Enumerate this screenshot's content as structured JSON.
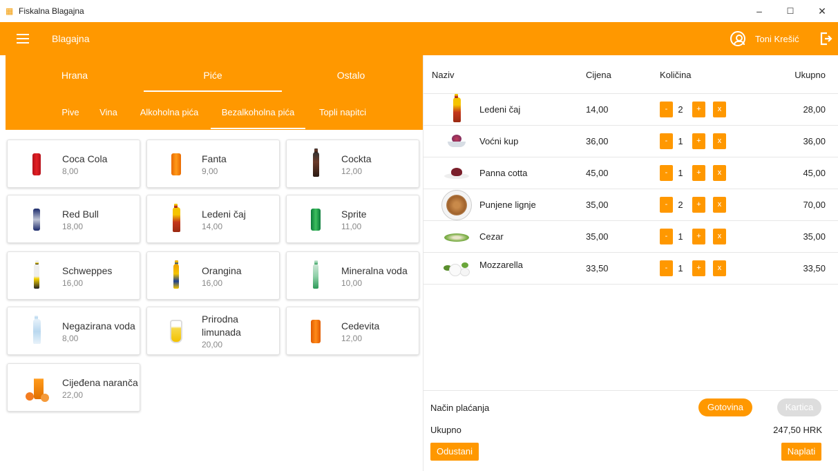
{
  "window": {
    "title": "Fiskalna Blagajna",
    "minimize": "–",
    "maximize": "☐",
    "close": "✕"
  },
  "appbar": {
    "title": "Blagajna",
    "user": "Toni Krešić"
  },
  "categories": [
    {
      "label": "Hrana",
      "active": false
    },
    {
      "label": "Piće",
      "active": true
    },
    {
      "label": "Ostalo",
      "active": false
    }
  ],
  "subcategories": [
    {
      "label": "Pive",
      "active": false
    },
    {
      "label": "Vina",
      "active": false
    },
    {
      "label": "Alkoholna pića",
      "active": false
    },
    {
      "label": "Bezalkoholna pića",
      "active": true
    },
    {
      "label": "Topli napitci",
      "active": false
    }
  ],
  "products": [
    {
      "name": "Coca Cola",
      "price": "8,00",
      "icon": "can-red"
    },
    {
      "name": "Fanta",
      "price": "9,00",
      "icon": "can-orange"
    },
    {
      "name": "Cockta",
      "price": "12,00",
      "icon": "bottle-dark"
    },
    {
      "name": "Red Bull",
      "price": "18,00",
      "icon": "can-blue"
    },
    {
      "name": "Ledeni čaj",
      "price": "14,00",
      "icon": "bottle-orange"
    },
    {
      "name": "Sprite",
      "price": "11,00",
      "icon": "can-green"
    },
    {
      "name": "Schweppes",
      "price": "16,00",
      "icon": "bottle-clear"
    },
    {
      "name": "Orangina",
      "price": "16,00",
      "icon": "bottle-yellow"
    },
    {
      "name": "Mineralna voda",
      "price": "10,00",
      "icon": "bottle-green"
    },
    {
      "name": "Negazirana voda",
      "price": "8,00",
      "icon": "bottle-water"
    },
    {
      "name": "Prirodna limunada",
      "price": "20,00",
      "icon": "jug-lemonade"
    },
    {
      "name": "Cedevita",
      "price": "12,00",
      "icon": "can-orange"
    },
    {
      "name": "Cijeđena naranča",
      "price": "22,00",
      "icon": "bottle-orange-juice"
    }
  ],
  "order": {
    "headers": {
      "name": "Naziv",
      "price": "Cijena",
      "qty": "Količina",
      "total": "Ukupno"
    },
    "buttons": {
      "minus": "-",
      "plus": "+",
      "remove": "x"
    },
    "rows": [
      {
        "name": "Ledeni čaj",
        "price": "14,00",
        "qty": "2",
        "total": "28,00",
        "icon": "bottle-orange"
      },
      {
        "name": "Voćni kup",
        "price": "36,00",
        "qty": "1",
        "total": "36,00",
        "icon": "fruit-bowl"
      },
      {
        "name": "Panna cotta",
        "price": "45,00",
        "qty": "1",
        "total": "45,00",
        "icon": "dessert"
      },
      {
        "name": "Punjene lignje",
        "price": "35,00",
        "qty": "2",
        "total": "70,00",
        "icon": "plate-squid"
      },
      {
        "name": "Cezar",
        "price": "35,00",
        "qty": "1",
        "total": "35,00",
        "icon": "salad"
      },
      {
        "name": "Mozzarella",
        "price": "33,50",
        "qty": "1",
        "total": "33,50",
        "icon": "mozzarella"
      }
    ]
  },
  "footer": {
    "payment_label": "Način plaćanja",
    "cash": "Gotovina",
    "card": "Kartica",
    "total_label": "Ukupno",
    "total_value": "247,50 HRK",
    "cancel": "Odustani",
    "pay": "Naplati"
  },
  "colors": {
    "accent": "#ff9800",
    "disabled": "#dddddd"
  }
}
